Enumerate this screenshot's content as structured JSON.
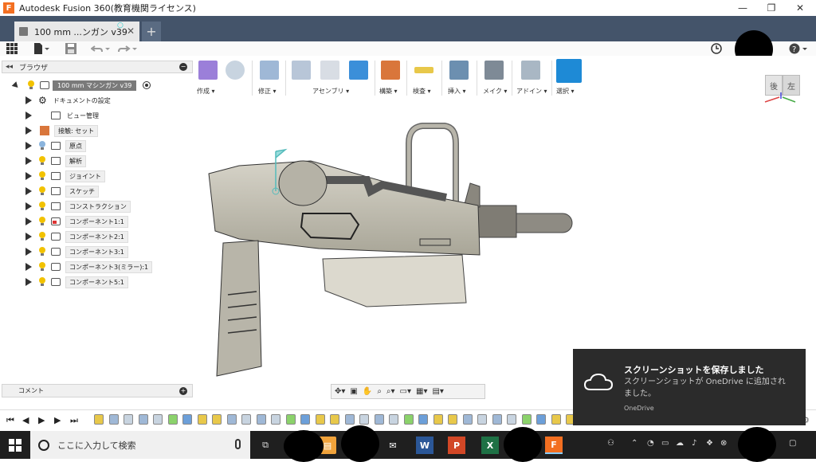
{
  "window": {
    "app_icon_letter": "F",
    "title": "Autodesk Fusion 360(教育機関ライセンス)",
    "minimize": "—",
    "restore": "❐",
    "close": "✕"
  },
  "tab": {
    "label": "100 mm ...ンガン v39",
    "close": "✕",
    "new_tab": "+"
  },
  "ribbon": {
    "groups": [
      {
        "label": "作成 ▾"
      },
      {
        "label": "修正 ▾"
      },
      {
        "label": "アセンブリ ▾"
      },
      {
        "label": "構築 ▾"
      },
      {
        "label": "検査 ▾"
      },
      {
        "label": "挿入 ▾"
      },
      {
        "label": "メイク ▾"
      },
      {
        "label": "アドイン ▾"
      },
      {
        "label": "選択 ▾"
      }
    ]
  },
  "browser": {
    "header_arrows": "◂◂",
    "title": "ブラウザ",
    "collapse": "−",
    "root_label": "100 mm マシンガン v39",
    "items": [
      {
        "label": "ドキュメントの設定"
      },
      {
        "label": "ビュー管理"
      },
      {
        "label": "接触: セット"
      },
      {
        "label": "原点"
      },
      {
        "label": "解析"
      },
      {
        "label": "ジョイント"
      },
      {
        "label": "スケッチ"
      },
      {
        "label": "コンストラクション"
      },
      {
        "label": "コンポーネント1:1"
      },
      {
        "label": "コンポーネント2:1"
      },
      {
        "label": "コンポーネント3:1"
      },
      {
        "label": "コンポーネント3(ミラー):1"
      },
      {
        "label": "コンポーネント5:1"
      }
    ]
  },
  "comment": {
    "title": "コメント",
    "add": "+"
  },
  "viewcube": {
    "back": "後",
    "left": "左"
  },
  "notification": {
    "title": "スクリーンショットを保存しました",
    "body": "スクリーンショットが OneDrive に追加されました。",
    "source": "OneDrive"
  },
  "taskbar": {
    "search_placeholder": "ここに入力して検索",
    "word_letter": "W",
    "ppt_letter": "P",
    "excel_letter": "X",
    "fusion_letter": "F"
  },
  "colors": {
    "tabbar": "#44546a",
    "toast_bg": "#2b2b2b",
    "taskbar": "#1f1f1f",
    "model_fill": "#c9c6bb"
  }
}
